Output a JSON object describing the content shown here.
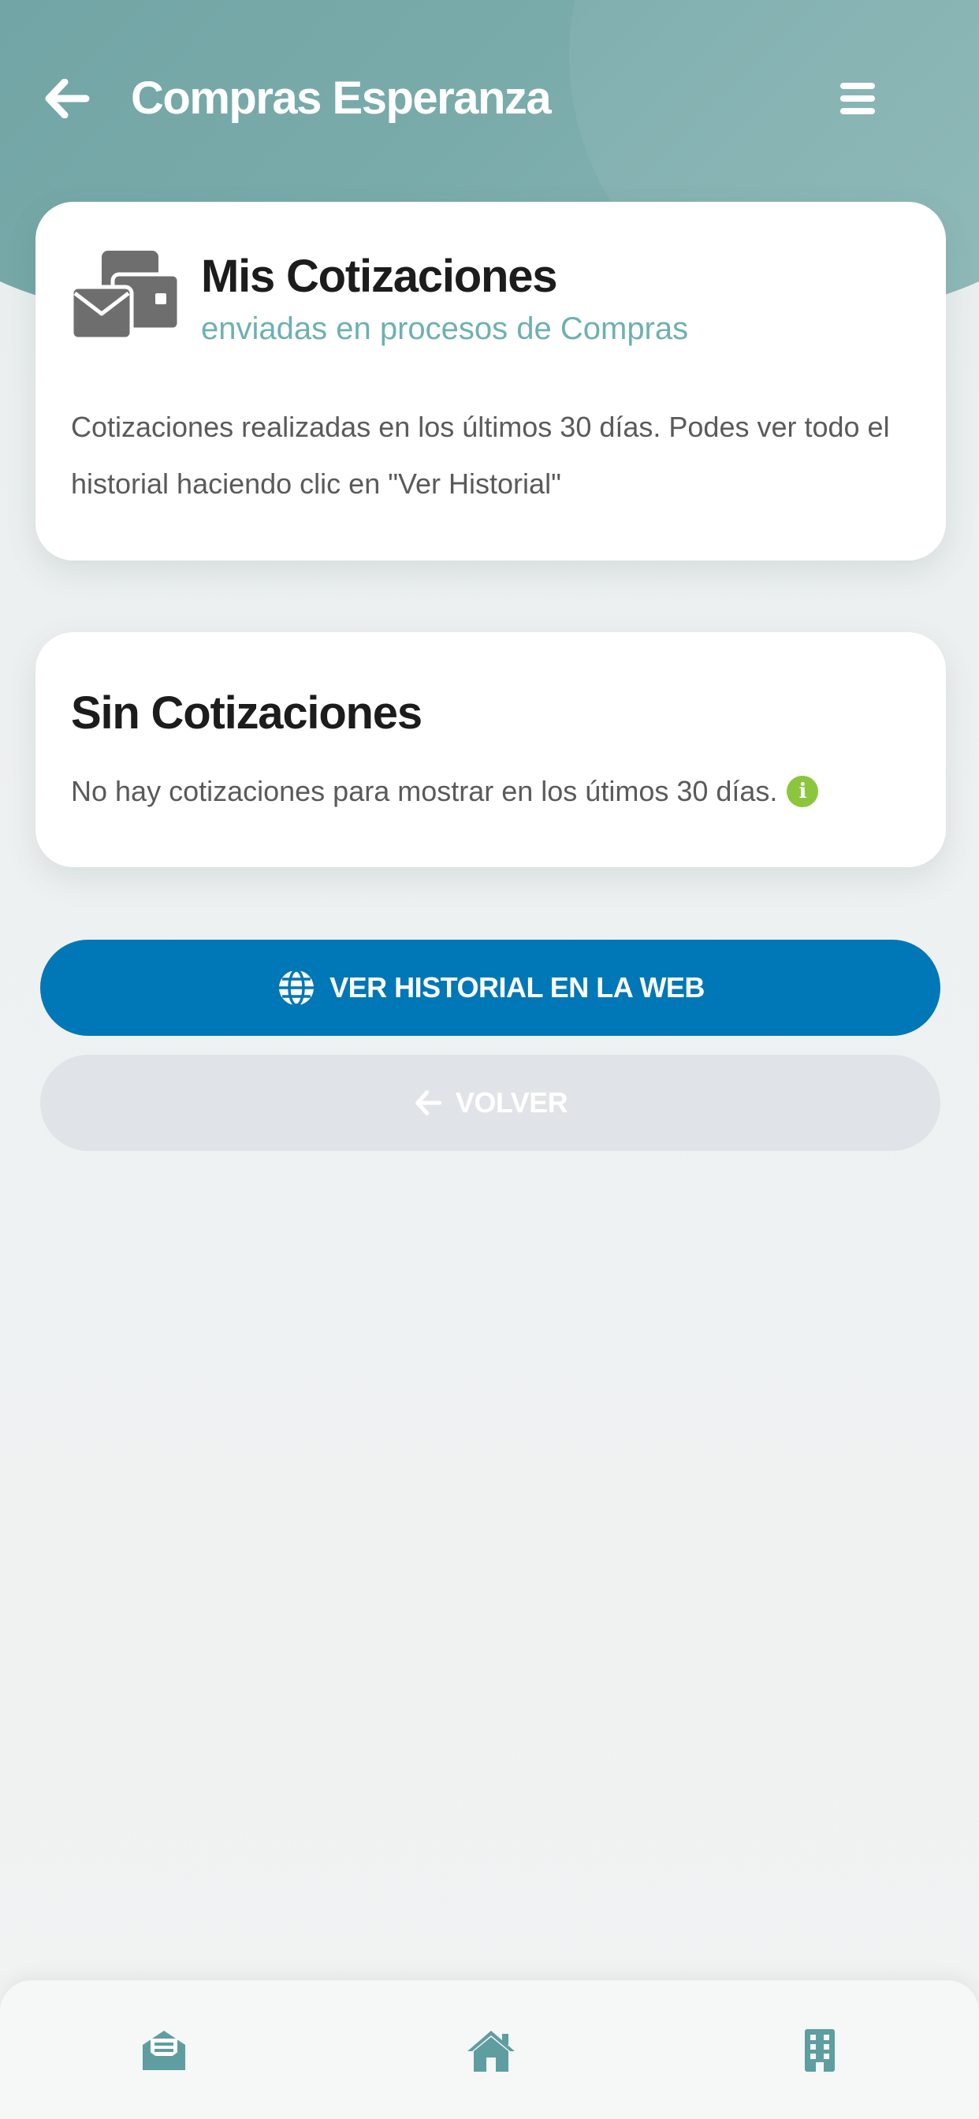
{
  "header": {
    "title": "Compras Esperanza",
    "back_icon": "arrow-left-icon",
    "menu_icon": "hamburger-menu-icon"
  },
  "quotes_card": {
    "icon": "mail-wallet-icon",
    "title": "Mis Cotizaciones",
    "subtitle": "enviadas en procesos de Compras",
    "description": "Cotizaciones realizadas en los últimos 30 días. Podes ver todo el historial haciendo clic en \"Ver Historial\""
  },
  "empty_card": {
    "title": "Sin Cotizaciones",
    "description": "No hay cotizaciones para mostrar en los útimos 30 días.",
    "info_icon": "info-circle-icon"
  },
  "actions": {
    "history_label": "VER HISTORIAL EN LA WEB",
    "history_icon": "globe-icon",
    "back_label": "VOLVER",
    "back_icon": "arrow-left-icon"
  },
  "bottom_nav": {
    "items": [
      {
        "icon": "envelope-open-icon"
      },
      {
        "icon": "home-icon"
      },
      {
        "icon": "building-icon"
      }
    ]
  },
  "colors": {
    "header": "#7aabab",
    "accent_teal": "#6fb0b0",
    "primary_button": "#0077b6",
    "secondary_button": "#e0e4e8",
    "info_green": "#8cc63f",
    "nav_icon": "#5f9ea0"
  }
}
